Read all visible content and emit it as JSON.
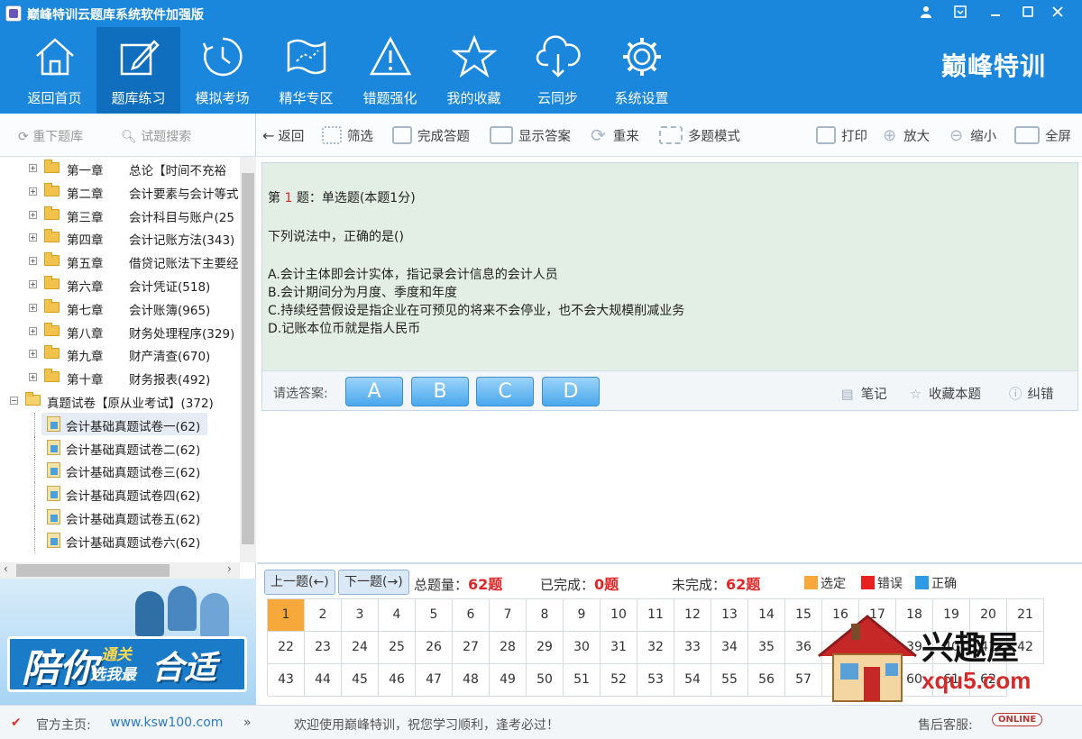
{
  "app": {
    "title": "巅峰特训云题库系统软件加强版"
  },
  "window_controls": [
    "user-icon",
    "menu-icon",
    "minimize-icon",
    "maximize-icon",
    "close-icon"
  ],
  "nav": [
    {
      "label": "返回首页",
      "icon": "home-icon"
    },
    {
      "label": "题库练习",
      "icon": "edit-icon",
      "active": true
    },
    {
      "label": "模拟考场",
      "icon": "clock-icon"
    },
    {
      "label": "精华专区",
      "icon": "map-icon"
    },
    {
      "label": "错题强化",
      "icon": "warning-icon"
    },
    {
      "label": "我的收藏",
      "icon": "star-icon"
    },
    {
      "label": "云同步",
      "icon": "cloud-icon"
    },
    {
      "label": "系统设置",
      "icon": "gear-icon"
    }
  ],
  "brand": "巅峰特训",
  "left_tools": {
    "download": "重下题库",
    "search": "试题搜索"
  },
  "tree": {
    "chapters": [
      {
        "ch": "第一章",
        "name": "总论【时间不充裕"
      },
      {
        "ch": "第二章",
        "name": "会计要素与会计等式"
      },
      {
        "ch": "第三章",
        "name": "会计科目与账户(25"
      },
      {
        "ch": "第四章",
        "name": "会计记账方法(343)"
      },
      {
        "ch": "第五章",
        "name": "借贷记账法下主要经"
      },
      {
        "ch": "第六章",
        "name": "会计凭证(518)"
      },
      {
        "ch": "第七章",
        "name": "会计账簿(965)"
      },
      {
        "ch": "第八章",
        "name": "财务处理程序(329)"
      },
      {
        "ch": "第九章",
        "name": "财产清查(670)"
      },
      {
        "ch": "第十章",
        "name": "财务报表(492)"
      }
    ],
    "exam_group": "真题试卷【原从业考试】(372)",
    "exams": [
      "会计基础真题试卷一(62)",
      "会计基础真题试卷二(62)",
      "会计基础真题试卷三(62)",
      "会计基础真题试卷四(62)",
      "会计基础真题试卷五(62)",
      "会计基础真题试卷六(62)"
    ]
  },
  "banner": {
    "t1": "陪你",
    "t2": "通关",
    "t3": "选我最",
    "t4": "合适"
  },
  "toolbar": {
    "back": "返回",
    "filter": "筛选",
    "finish": "完成答题",
    "show_answer": "显示答案",
    "redo": "重来",
    "multi_mode": "多题模式",
    "print": "打印",
    "zoom_in": "放大",
    "zoom_out": "缩小",
    "fullscreen": "全屏"
  },
  "question": {
    "prefix": "第",
    "number": "1",
    "suffix": "题：单选题(本题1分)",
    "stem": "下列说法中，正确的是()",
    "options": [
      "A.会计主体即会计实体，指记录会计信息的会计人员",
      "B.会计期间分为月度、季度和年度",
      "C.持续经营假设是指企业在可预见的将来不会停业，也不会大规模削减业务",
      "D.记账本位币就是指人民币"
    ]
  },
  "answer_bar": {
    "label": "请选答案:",
    "choices": [
      "A",
      "B",
      "C",
      "D"
    ],
    "note": "笔记",
    "favorite": "收藏本题",
    "report": "纠错"
  },
  "sheet": {
    "prev": "上一题(←)",
    "next": "下一题(→)",
    "total_label": "总题量：",
    "total": "62题",
    "done_label": "已完成：",
    "done": "0题",
    "todo_label": "未完成：",
    "todo": "62题",
    "legend": [
      {
        "label": "选定",
        "color": "#f7a83b"
      },
      {
        "label": "错误",
        "color": "#e82020"
      },
      {
        "label": "正确",
        "color": "#2f9be6"
      }
    ],
    "current": 1,
    "count": 62
  },
  "status": {
    "home_label": "官方主页:",
    "home_url": "www.ksw100.com",
    "welcome": "欢迎使用巅峰特训，祝您学习顺利，逢考必过！",
    "service": "售后客服:",
    "online": "ONLINE"
  },
  "watermark": {
    "text": "兴趣屋",
    "url": "xqu5.com"
  }
}
